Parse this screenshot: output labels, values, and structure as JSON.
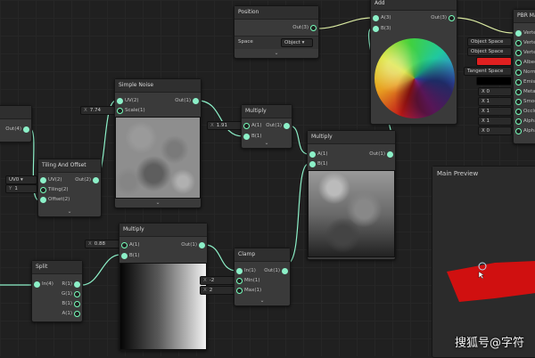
{
  "nodes": {
    "left_partial": {
      "out": "Out(4)"
    },
    "tiling": {
      "title": "Tiling And Offset",
      "in1": "UV(2)",
      "in2": "Tiling(2)",
      "in3": "Offset(2)",
      "out": "Out(2)",
      "uv_value": "UV0 ▾",
      "y_value": "1"
    },
    "noise": {
      "title": "Simple Noise",
      "in1": "UV(2)",
      "in2": "Scale(1)",
      "out": "Out(1)",
      "scale_label": "X",
      "scale_value": "7.74"
    },
    "multiply_top": {
      "title": "Multiply",
      "in1": "A(1)",
      "in2": "B(1)",
      "out": "Out(1)",
      "a_label": "X",
      "a_value": "1.91"
    },
    "multiply_right": {
      "title": "Multiply",
      "in1": "A(1)",
      "in2": "B(1)",
      "out": "Out(1)"
    },
    "position": {
      "title": "Position",
      "out": "Out(3)",
      "space_label": "Space",
      "space_value": "Object"
    },
    "add": {
      "title": "Add",
      "in1": "A(3)",
      "in2": "B(3)",
      "out": "Out(3)"
    },
    "pbr": {
      "title": "PBR Ma",
      "fields": [
        {
          "value": "Object Space",
          "port": "Verte"
        },
        {
          "value": "Object Space",
          "port": "Verte"
        },
        {
          "value": "",
          "port": "Albed"
        },
        {
          "value": "Tangent Space",
          "port": "Norm"
        },
        {
          "value": "",
          "port": "Emiss"
        },
        {
          "value": "X  0",
          "port": "Metal"
        },
        {
          "value": "X  1",
          "port": "Smoo"
        },
        {
          "value": "X  1",
          "port": "Occlu"
        },
        {
          "value": "X  1",
          "port": "Alpha"
        },
        {
          "value": "X  0",
          "port": "Alpha"
        }
      ],
      "top_port": "Verte"
    },
    "multiply_bottom": {
      "title": "Multiply",
      "in1": "A(1)",
      "in2": "B(1)",
      "out": "Out(1)",
      "a_label": "X",
      "a_value": "0.88"
    },
    "split": {
      "title": "Split",
      "in1": "In(4)",
      "o1": "R(1)",
      "o2": "G(1)",
      "o3": "B(1)",
      "o4": "A(1)"
    },
    "clamp": {
      "title": "Clamp",
      "in1": "In(1)",
      "in2": "Min(1)",
      "in3": "Max(1)",
      "out": "Out(1)",
      "min_label": "X",
      "min_value": "-2",
      "max_label": "X",
      "max_value": "2"
    }
  },
  "main_preview": {
    "title": "Main Preview"
  },
  "watermark": "搜狐号@字符",
  "colors": {
    "albedo": "#e02020",
    "emission": "#000000",
    "wire": "#d8e8a0",
    "wire_float": "#8cf0c8",
    "preview_red": "#d01010"
  }
}
